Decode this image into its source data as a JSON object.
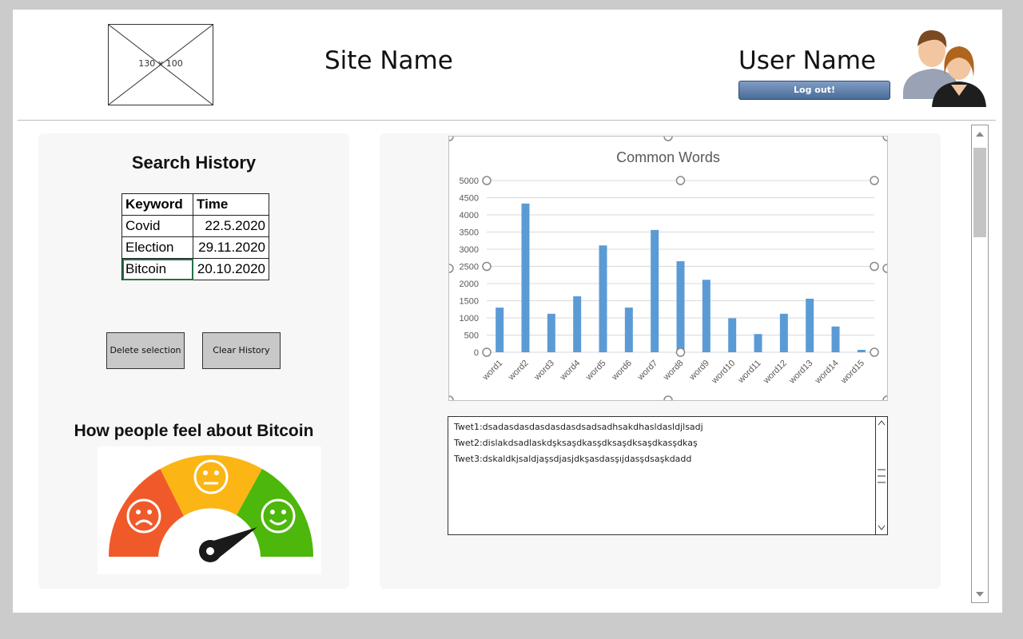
{
  "header": {
    "logo_placeholder": "130 x 100",
    "site_name": "Site Name",
    "user_name": "User Name",
    "logout_label": "Log out!"
  },
  "search_history": {
    "title": "Search History",
    "columns": [
      "Keyword",
      "Time"
    ],
    "rows": [
      {
        "keyword": "Covid",
        "time": "22.5.2020"
      },
      {
        "keyword": "Election",
        "time": "29.11.2020"
      },
      {
        "keyword": "Bitcoin",
        "time": "20.10.2020"
      }
    ],
    "delete_label": "Delete selection",
    "clear_label": "Clear History"
  },
  "sentiment": {
    "title": "How people feel about Bitcoin",
    "level": "positive",
    "colors": {
      "negative": "#f05a2a",
      "neutral": "#fbb615",
      "positive": "#4db70b"
    }
  },
  "chart_data": {
    "type": "bar",
    "title": "Common Words",
    "categories": [
      "word1",
      "word2",
      "word3",
      "word4",
      "word5",
      "word6",
      "word7",
      "word8",
      "word9",
      "word10",
      "word11",
      "word12",
      "word13",
      "word14",
      "word15"
    ],
    "values": [
      1300,
      4330,
      1120,
      1630,
      3110,
      1300,
      3560,
      2650,
      2110,
      990,
      530,
      1120,
      1560,
      750,
      70
    ],
    "ylim": [
      0,
      5000
    ],
    "yticks": [
      "0",
      "500",
      "1000",
      "1500",
      "2000",
      "2500",
      "3000",
      "3500",
      "4000",
      "4500",
      "5000"
    ],
    "grid": true,
    "bar_color": "#5b9bd5"
  },
  "tweets": [
    "Twet1:dsadasdasdasdasdasdsadsadhsakdhasldasldjlsadj",
    "Twet2:dislakdsadlaskdşksaşdkasşdksaşdksaşdkasşdkaş",
    "Twet3:dskaldkjsaldjaşsdjasjdkşasdasşıjdasşdsaşkdadd"
  ]
}
